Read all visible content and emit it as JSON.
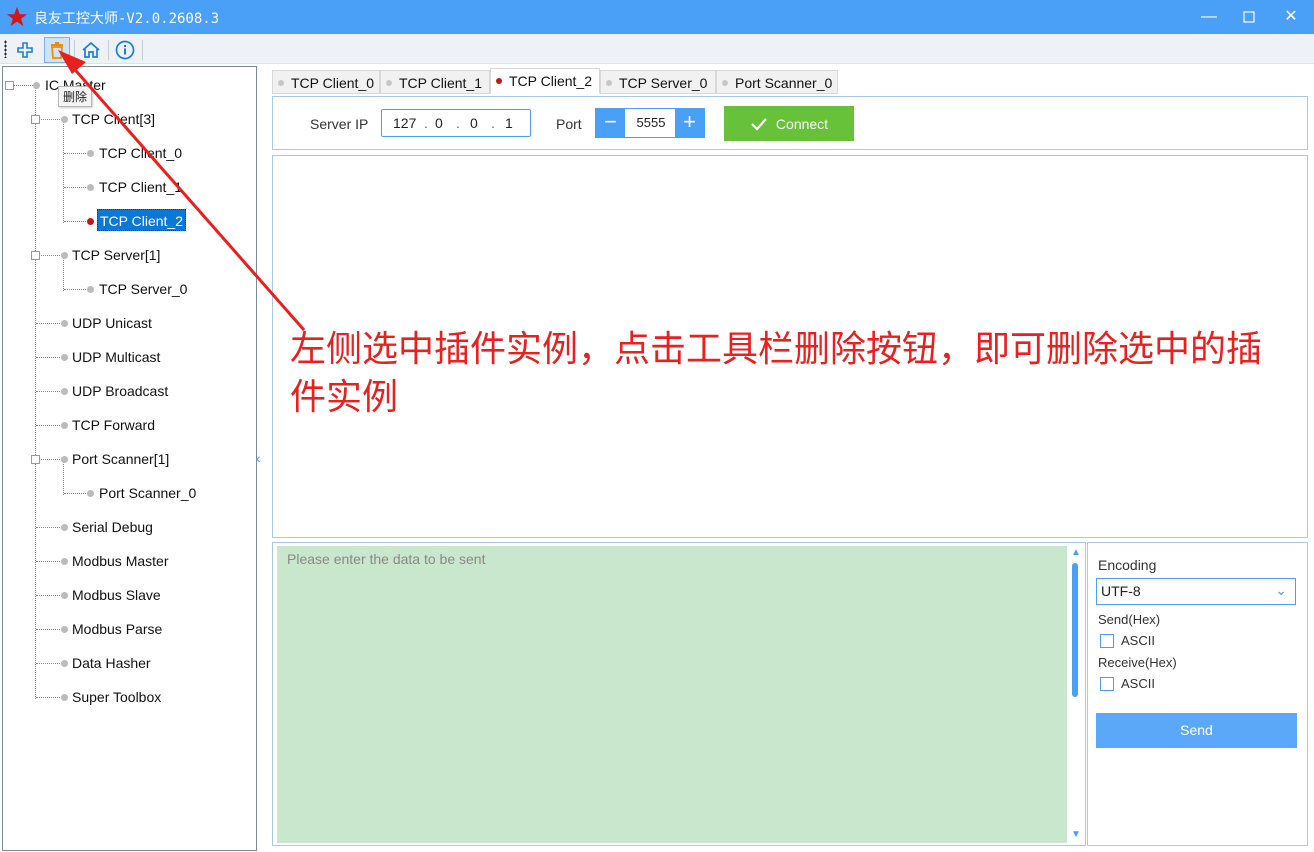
{
  "app": {
    "title": "良友工控大师-V2.0.2608.3"
  },
  "toolbar": {
    "tooltip": "删除"
  },
  "tree": {
    "root": "IC Master",
    "items": [
      {
        "label": "TCP Client[3]"
      },
      {
        "label": "TCP Client_0"
      },
      {
        "label": "TCP Client_1"
      },
      {
        "label": "TCP Client_2"
      },
      {
        "label": "TCP Server[1]"
      },
      {
        "label": "TCP Server_0"
      },
      {
        "label": "UDP Unicast"
      },
      {
        "label": "UDP Multicast"
      },
      {
        "label": "UDP Broadcast"
      },
      {
        "label": "TCP Forward"
      },
      {
        "label": "Port Scanner[1]"
      },
      {
        "label": "Port Scanner_0"
      },
      {
        "label": "Serial Debug"
      },
      {
        "label": "Modbus Master"
      },
      {
        "label": "Modbus Slave"
      },
      {
        "label": "Modbus Parse"
      },
      {
        "label": "Data Hasher"
      },
      {
        "label": "Super Toolbox"
      }
    ]
  },
  "tabs": [
    "TCP Client_0",
    "TCP Client_1",
    "TCP Client_2",
    "TCP Server_0",
    "Port Scanner_0"
  ],
  "connection": {
    "server_ip_label": "Server IP",
    "ip": [
      "127",
      "0",
      "0",
      "1"
    ],
    "port_label": "Port",
    "port": "5555",
    "connect_label": "Connect"
  },
  "send": {
    "placeholder": "Please enter the data to be sent"
  },
  "side": {
    "encoding_label": "Encoding",
    "encoding_value": "UTF-8",
    "send_hex_label": "Send(Hex)",
    "send_ascii": "ASCII",
    "recv_hex_label": "Receive(Hex)",
    "recv_ascii": "ASCII",
    "send_button": "Send"
  },
  "annotation": {
    "text": "左侧选中插件实例，点击工具栏删除按钮，即可删除选中的插件实例"
  },
  "colors": {
    "accent": "#4a9ff6",
    "connect": "#67c23a",
    "annotation": "#e8201e",
    "send_bg": "#c9e7cd"
  }
}
